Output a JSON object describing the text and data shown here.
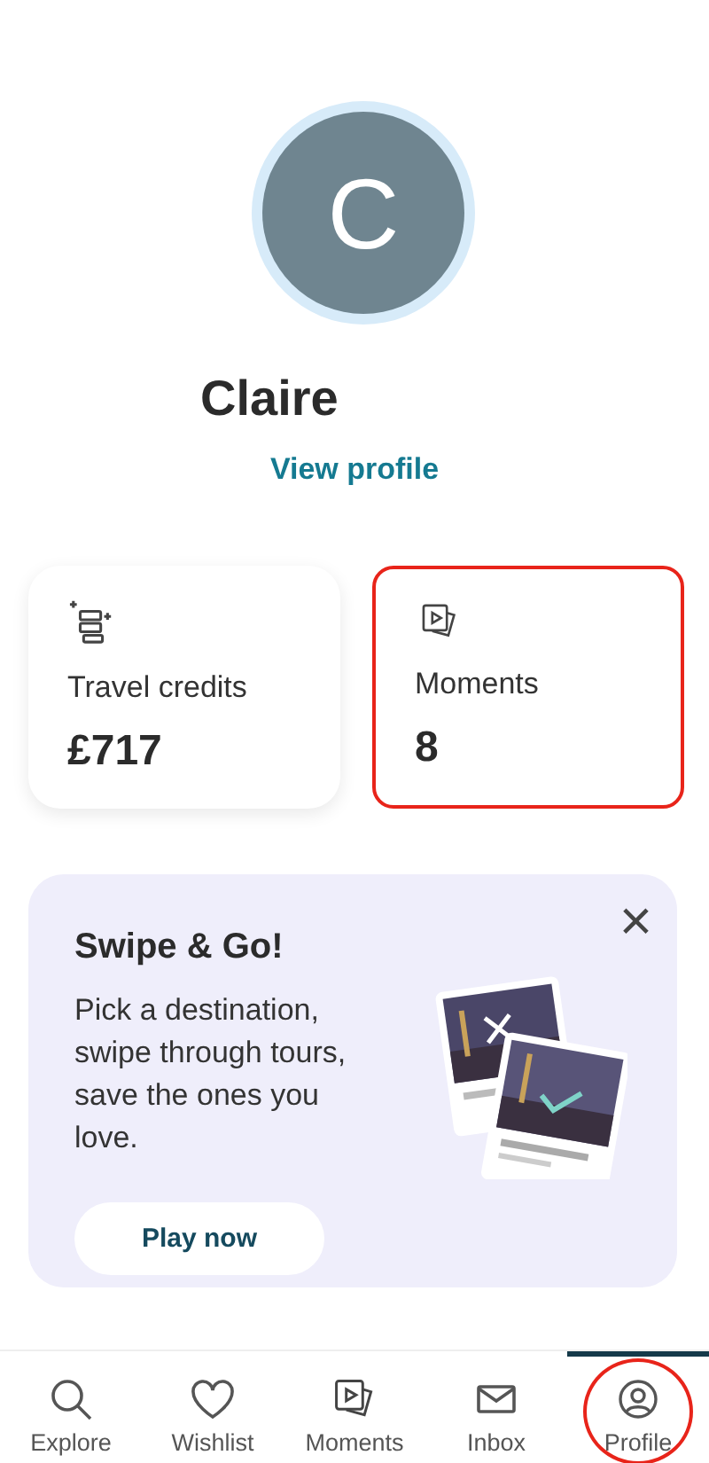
{
  "profile": {
    "initial": "C",
    "name": "Claire",
    "link": "View profile"
  },
  "stats": [
    {
      "kind": "credits",
      "label": "Travel credits",
      "value": "£717",
      "highlighted": false
    },
    {
      "kind": "moments",
      "label": "Moments",
      "value": "8",
      "highlighted": true
    }
  ],
  "promo": {
    "title": "Swipe & Go!",
    "text": "Pick a destination, swipe through tours, save the ones you love.",
    "button": "Play now",
    "close": "×"
  },
  "nav": [
    {
      "kind": "explore",
      "label": "Explore",
      "selected": false,
      "highlighted": false
    },
    {
      "kind": "wishlist",
      "label": "Wishlist",
      "selected": false,
      "highlighted": false
    },
    {
      "kind": "moments",
      "label": "Moments",
      "selected": false,
      "highlighted": false
    },
    {
      "kind": "inbox",
      "label": "Inbox",
      "selected": false,
      "highlighted": false
    },
    {
      "kind": "profile",
      "label": "Profile",
      "selected": true,
      "highlighted": true
    }
  ]
}
